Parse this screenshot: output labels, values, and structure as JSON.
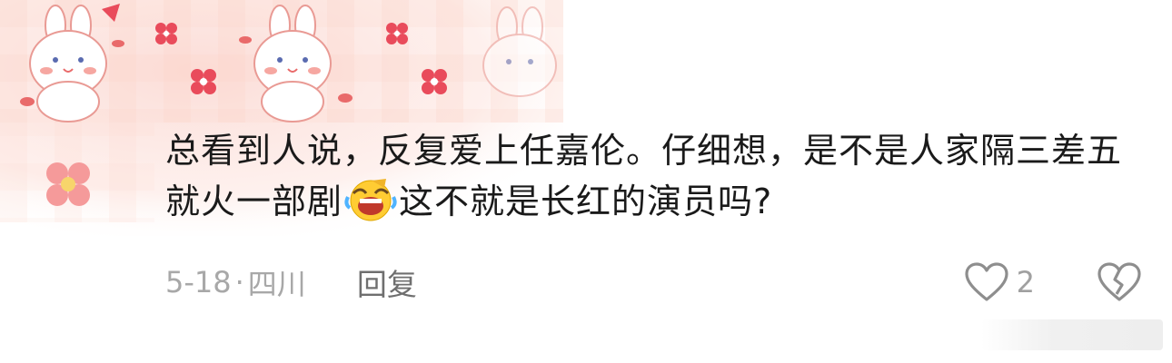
{
  "comment": {
    "text_part1": "总看到人说，反复爱上任嘉伦。仔细想，是不是人家隔三差五就火一部剧",
    "emoji": "laughing-emoji",
    "text_part2": "这不就是长红的演员吗?"
  },
  "meta": {
    "date": "5-18",
    "separator": "·",
    "location": "四川",
    "reply_label": "回复",
    "like_count": "2"
  },
  "icons": {
    "like": "heart-outline-icon",
    "dislike": "broken-heart-icon"
  },
  "colors": {
    "text": "#1a1a1a",
    "meta": "#a8a8a8",
    "reply": "#6f6f6f",
    "decor_pink": "#f7c9c4",
    "decor_red": "#e94b5b"
  }
}
